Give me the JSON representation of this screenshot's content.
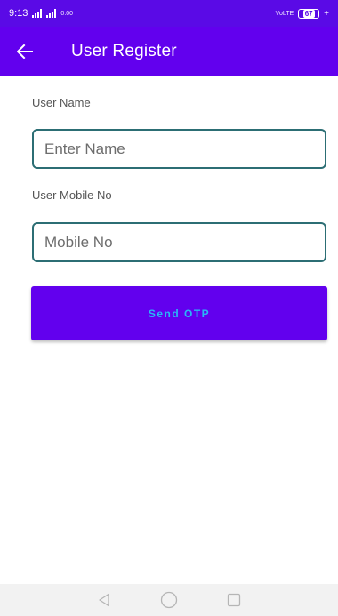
{
  "status_bar": {
    "time": "9:13",
    "data_speed": "0.00",
    "network_label": "VoLTE",
    "battery": "67",
    "icons": [
      "signal-icon",
      "signal-icon",
      "battery-icon",
      "charging-icon"
    ]
  },
  "app_bar": {
    "title": "User Register",
    "back_icon": "arrow-back-icon",
    "color": "#6200ee"
  },
  "form": {
    "name_label": "User Name",
    "name_placeholder": "Enter Name",
    "name_value": "",
    "mobile_label": "User Mobile No",
    "mobile_placeholder": "Mobile No",
    "mobile_value": "",
    "input_border_color": "#2c6e74"
  },
  "actions": {
    "send_otp_label": "Send OTP",
    "button_color": "#6200ee",
    "button_text_color": "#29b6f6"
  },
  "nav_bar": {
    "icons": [
      "back-triangle-icon",
      "home-circle-icon",
      "recents-square-icon"
    ]
  }
}
